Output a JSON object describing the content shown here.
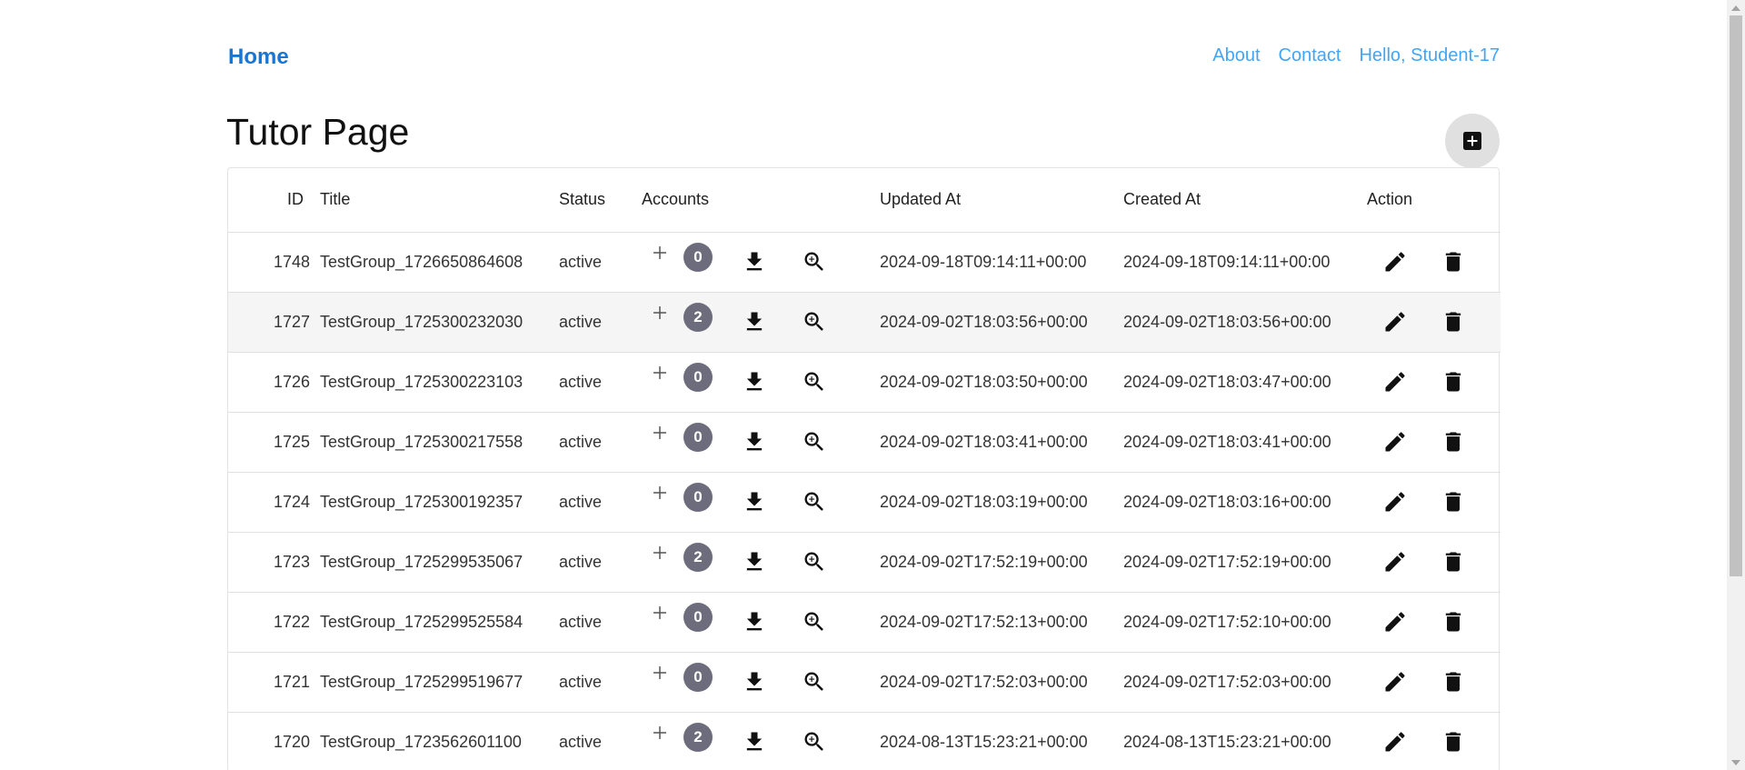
{
  "nav": {
    "home": "Home",
    "about": "About",
    "contact": "Contact",
    "greeting": "Hello, Student-17"
  },
  "page_title": "Tutor Page",
  "table": {
    "headers": {
      "id": "ID",
      "title": "Title",
      "status": "Status",
      "accounts": "Accounts",
      "updated_at": "Updated At",
      "created_at": "Created At",
      "action": "Action"
    },
    "rows": [
      {
        "id": "1748",
        "title": "TestGroup_1726650864608",
        "status": "active",
        "accounts": "0",
        "updated_at": "2024-09-18T09:14:11+00:00",
        "created_at": "2024-09-18T09:14:11+00:00"
      },
      {
        "id": "1727",
        "title": "TestGroup_1725300232030",
        "status": "active",
        "accounts": "2",
        "updated_at": "2024-09-02T18:03:56+00:00",
        "created_at": "2024-09-02T18:03:56+00:00"
      },
      {
        "id": "1726",
        "title": "TestGroup_1725300223103",
        "status": "active",
        "accounts": "0",
        "updated_at": "2024-09-02T18:03:50+00:00",
        "created_at": "2024-09-02T18:03:47+00:00"
      },
      {
        "id": "1725",
        "title": "TestGroup_1725300217558",
        "status": "active",
        "accounts": "0",
        "updated_at": "2024-09-02T18:03:41+00:00",
        "created_at": "2024-09-02T18:03:41+00:00"
      },
      {
        "id": "1724",
        "title": "TestGroup_1725300192357",
        "status": "active",
        "accounts": "0",
        "updated_at": "2024-09-02T18:03:19+00:00",
        "created_at": "2024-09-02T18:03:16+00:00"
      },
      {
        "id": "1723",
        "title": "TestGroup_1725299535067",
        "status": "active",
        "accounts": "2",
        "updated_at": "2024-09-02T17:52:19+00:00",
        "created_at": "2024-09-02T17:52:19+00:00"
      },
      {
        "id": "1722",
        "title": "TestGroup_1725299525584",
        "status": "active",
        "accounts": "0",
        "updated_at": "2024-09-02T17:52:13+00:00",
        "created_at": "2024-09-02T17:52:10+00:00"
      },
      {
        "id": "1721",
        "title": "TestGroup_1725299519677",
        "status": "active",
        "accounts": "0",
        "updated_at": "2024-09-02T17:52:03+00:00",
        "created_at": "2024-09-02T17:52:03+00:00"
      },
      {
        "id": "1720",
        "title": "TestGroup_1723562601100",
        "status": "active",
        "accounts": "2",
        "updated_at": "2024-08-13T15:23:21+00:00",
        "created_at": "2024-08-13T15:23:21+00:00"
      }
    ]
  },
  "icons": {
    "add_group": "plus-box-icon",
    "add_account": "plus-icon",
    "download": "download-icon",
    "view": "zoom-in-icon",
    "edit": "pencil-icon",
    "delete": "trash-icon"
  },
  "colors": {
    "home_link": "#1976d2",
    "nav_link": "#42a5f5",
    "badge": "#6c6c7c",
    "shaded_row": "#f5f5f5",
    "fab": "#e0e0e0"
  }
}
